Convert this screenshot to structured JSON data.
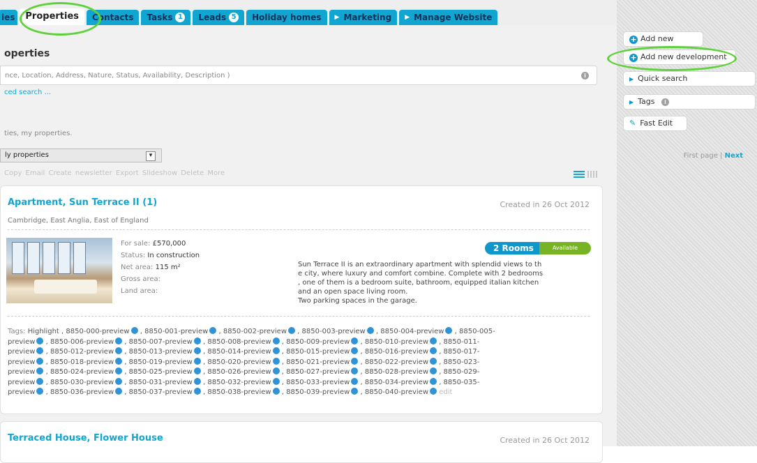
{
  "tabs": [
    {
      "label": "ies",
      "badge": ""
    },
    {
      "label": "Properties",
      "badge": ""
    },
    {
      "label": "Contacts",
      "badge": ""
    },
    {
      "label": "Tasks",
      "badge": "1"
    },
    {
      "label": "Leads",
      "badge": "5"
    },
    {
      "label": "Holiday homes",
      "badge": ""
    },
    {
      "label": "Marketing",
      "badge": ""
    },
    {
      "label": "Manage Website",
      "badge": ""
    }
  ],
  "page": {
    "title": "operties",
    "search_placeholder": "nce, Location, Address, Nature, Status, Availability, Description )",
    "advanced_search": "ced search ...",
    "filter_text": "ties, my properties.",
    "select_value": "ly properties",
    "pager_first": "First page",
    "pager_sep": "|",
    "pager_next": "Next",
    "actions": "Copy Email Create newsletter Export Slideshow Delete More"
  },
  "listing1": {
    "title": "Apartment, Sun Terrace II (1)",
    "created": "Created in 26 Oct 2012",
    "location": "Cambridge, East Anglia, East of England",
    "sale_label": "For sale:",
    "sale_value": "£570,000",
    "status_label": "Status:",
    "status_value": "In construction",
    "net_label": "Net area:",
    "net_value": "115 m²",
    "gross_label": "Gross area:",
    "land_label": "Land area:",
    "rooms": "2 Rooms",
    "availability": "Available",
    "desc_lines": [
      "Sun Terrace II is an extraordinary apartment with splendid views to th",
      "e city, where luxury and comfort combine. Complete with 2 bedrooms",
      ", one of them is a bedroom suite, bathroom, equipped italian kitchen",
      "and an open space living room.",
      "Two parking spaces in the garage."
    ],
    "tags_label": "Tags:",
    "tags_lines": [
      [
        "Highlight ,",
        "8850-000-preview",
        ", 8850-001-preview",
        ", 8850-002-preview",
        ", 8850-003-preview",
        ", 8850-004-preview",
        ", 8850-005-"
      ],
      [
        "preview",
        ", 8850-006-preview",
        ", 8850-007-preview",
        ", 8850-008-preview",
        ", 8850-009-preview",
        ", 8850-010-preview",
        ", 8850-011-"
      ],
      [
        "preview",
        ", 8850-012-preview",
        ", 8850-013-preview",
        ", 8850-014-preview",
        ", 8850-015-preview",
        ", 8850-016-preview",
        ", 8850-017-"
      ],
      [
        "preview",
        ", 8850-018-preview",
        ", 8850-019-preview",
        ", 8850-020-preview",
        ", 8850-021-preview",
        ", 8850-022-preview",
        ", 8850-023-"
      ],
      [
        "preview",
        ", 8850-024-preview",
        ", 8850-025-preview",
        ", 8850-026-preview",
        ", 8850-027-preview",
        ", 8850-028-preview",
        ", 8850-029-"
      ],
      [
        "preview",
        ", 8850-030-preview",
        ", 8850-031-preview",
        ", 8850-032-preview",
        ", 8850-033-preview",
        ", 8850-034-preview",
        ", 8850-035-"
      ],
      [
        "preview",
        ", 8850-036-preview",
        ", 8850-037-preview",
        ", 8850-038-preview",
        ", 8850-039-preview",
        ", 8850-040-preview"
      ]
    ],
    "tags_edit": "edit"
  },
  "listing2": {
    "title": "Terraced House, Flower House",
    "created": "Created in 26 Oct 2012"
  },
  "sidebar": {
    "add_property": "Add new property",
    "add_development": "Add new development",
    "quick_search": "Quick search",
    "tags": "Tags",
    "fast_edit": "Fast Edit"
  },
  "colors": {
    "accent": "#11a6d1",
    "available": "#78b326",
    "highlight_ring": "#5fd13a"
  }
}
